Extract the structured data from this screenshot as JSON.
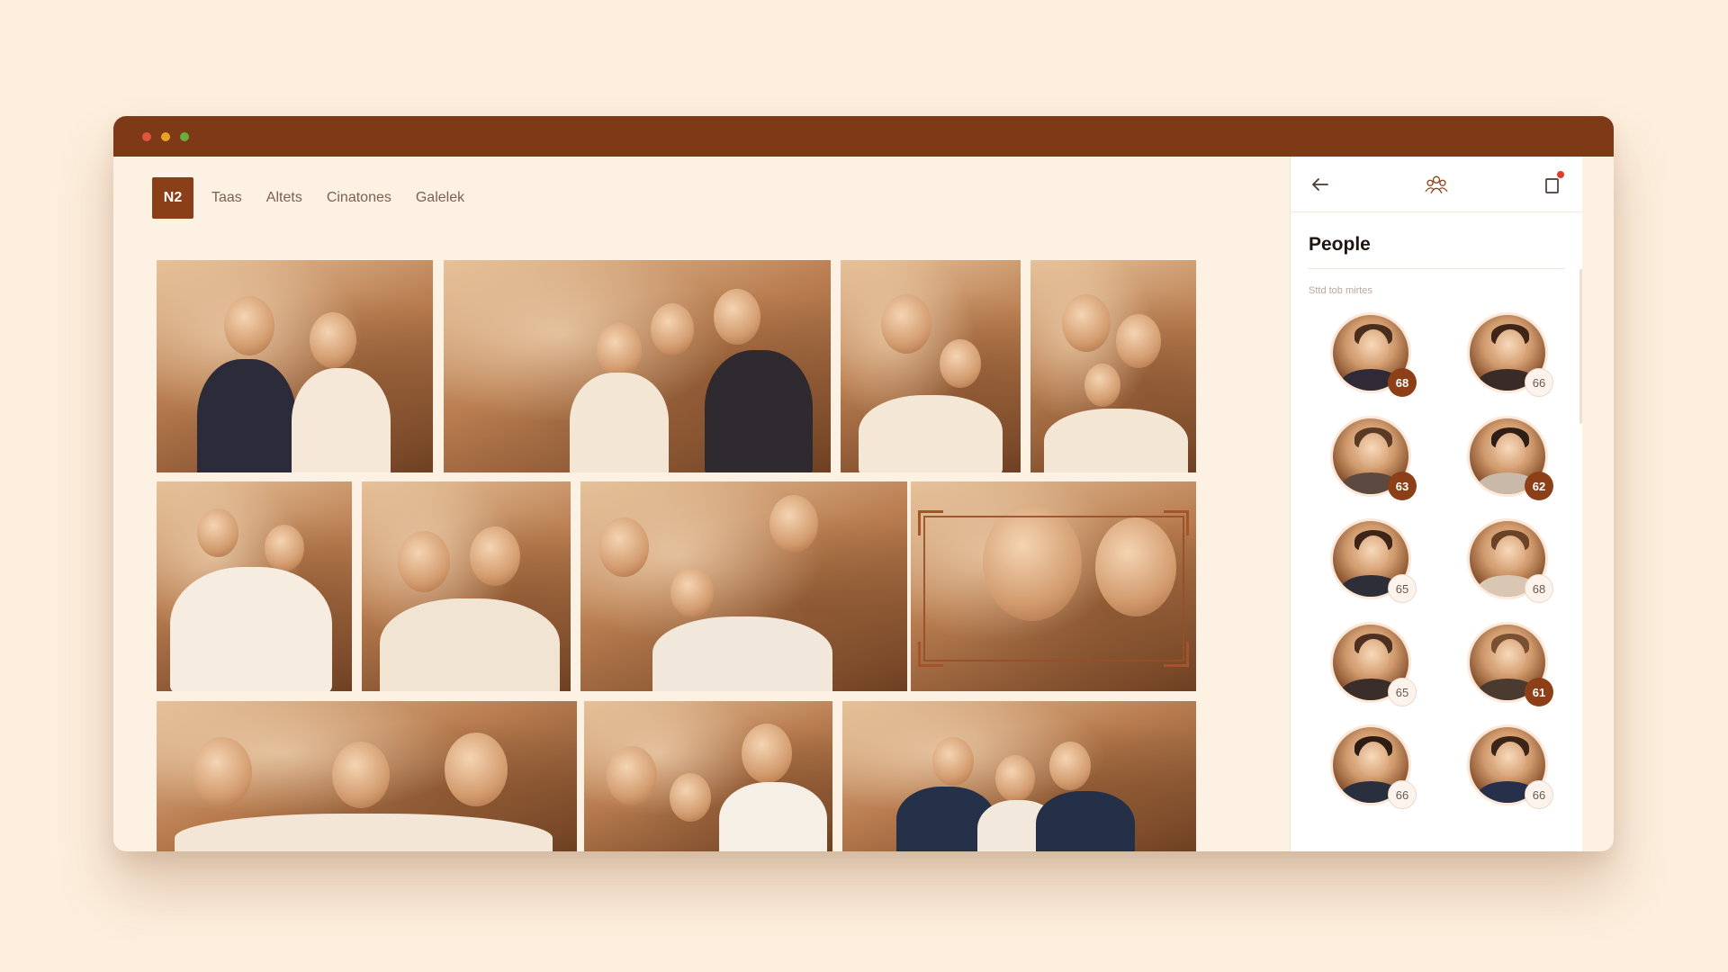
{
  "colors": {
    "background": "#fdeedd",
    "titlebar": "#7e3a16",
    "accent": "#8b3f18",
    "dot_red": "#e2563d",
    "dot_yellow": "#e8a327",
    "dot_green": "#6aae3b"
  },
  "nav": {
    "logo": "N2",
    "links": [
      "Taas",
      "Altets",
      "Cinatones",
      "Galelek"
    ]
  },
  "photos": [
    {
      "label": "bride-groom-floral-arch"
    },
    {
      "label": "couple-with-baby-garden"
    },
    {
      "label": "mother-and-daughter"
    },
    {
      "label": "couple-with-toddler"
    },
    {
      "label": "family-with-two-babies"
    },
    {
      "label": "bride-groom-close-up"
    },
    {
      "label": "family-with-baby-table"
    },
    {
      "label": "two-women-selfie-focused"
    },
    {
      "label": "mother-with-children-flowers"
    },
    {
      "label": "family-portrait-outdoor"
    },
    {
      "label": "group-outdoor-wedding"
    }
  ],
  "panel": {
    "back_icon": "arrow-left-icon",
    "people_icon": "people-group-icon",
    "device_icon": "phone-notification-icon",
    "title": "People",
    "subtitle": "Sttd tob mirtes",
    "people": [
      {
        "count": "68",
        "style": "dark"
      },
      {
        "count": "66",
        "style": "light"
      },
      {
        "count": "63",
        "style": "dark"
      },
      {
        "count": "62",
        "style": "dark"
      },
      {
        "count": "65",
        "style": "light"
      },
      {
        "count": "68",
        "style": "light"
      },
      {
        "count": "65",
        "style": "light"
      },
      {
        "count": "61",
        "style": "dark"
      },
      {
        "count": "66",
        "style": "light"
      },
      {
        "count": "66",
        "style": "light"
      }
    ]
  }
}
